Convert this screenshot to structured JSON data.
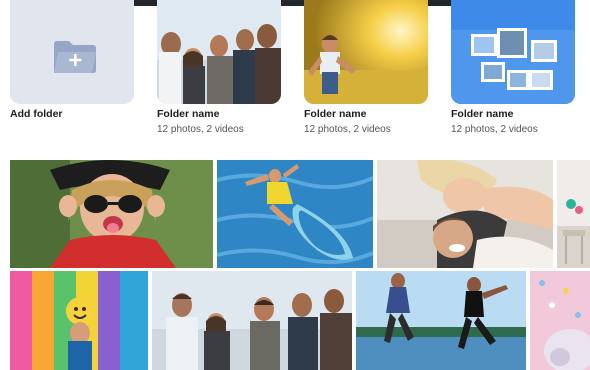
{
  "add_folder": {
    "label": "Add folder"
  },
  "folders": [
    {
      "name": "Folder name",
      "subtitle": "12 photos, 2 videos",
      "thumb": "group-of-friends-photo"
    },
    {
      "name": "Folder name",
      "subtitle": "12 photos, 2 videos",
      "thumb": "child-in-sunny-field-photo"
    },
    {
      "name": "Folder name",
      "subtitle": "12 photos, 2 videos",
      "thumb": "photo-collage-folder"
    }
  ],
  "photos": [
    {
      "name": "girl-with-sunglasses-photo"
    },
    {
      "name": "pool-float-photo"
    },
    {
      "name": "couple-hug-photo"
    },
    {
      "name": "room-photo"
    },
    {
      "name": "colorful-wall-photo"
    },
    {
      "name": "friends-group-photo"
    },
    {
      "name": "dancing-on-beach-photo"
    },
    {
      "name": "pastel-decor-photo"
    }
  ],
  "colors": {
    "accent": "#3d8ae8",
    "folder_bg": "#e1e5ee"
  },
  "icons": {
    "add_folder": "folder-plus-icon"
  }
}
